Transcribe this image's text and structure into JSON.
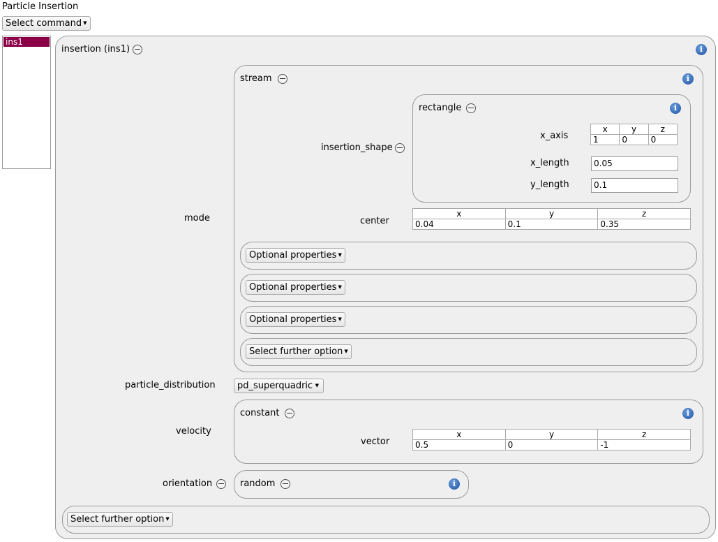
{
  "window_title": "Particle Insertion",
  "select_command": "Select command",
  "list_items": [
    "ins1"
  ],
  "insertion": {
    "title": "insertion (ins1)",
    "mode_label": "mode",
    "stream": {
      "title": "stream",
      "insertion_shape_label": "insertion_shape",
      "rectangle": {
        "title": "rectangle",
        "x_axis_label": "x_axis",
        "x_axis": {
          "headers": [
            "x",
            "y",
            "z"
          ],
          "values": [
            "1",
            "0",
            "0"
          ]
        },
        "x_length_label": "x_length",
        "x_length": "0.05",
        "y_length_label": "y_length",
        "y_length": "0.1"
      },
      "center_label": "center",
      "center": {
        "headers": [
          "x",
          "y",
          "z"
        ],
        "values": [
          "0.04",
          "0.1",
          "0.35"
        ]
      },
      "optional_properties": [
        "Optional properties",
        "Optional properties",
        "Optional properties"
      ],
      "select_further_option": "Select further option"
    },
    "particle_distribution_label": "particle_distribution",
    "particle_distribution": "pd_superquadric",
    "velocity_label": "velocity",
    "constant": {
      "title": "constant",
      "vector_label": "vector",
      "vector": {
        "headers": [
          "x",
          "y",
          "z"
        ],
        "values": [
          "0.5",
          "0",
          "-1"
        ]
      }
    },
    "orientation_label": "orientation",
    "orientation_value": "random",
    "select_further_option": "Select further option"
  },
  "icons": {
    "info": "info-icon",
    "collapse": "minus-circle-icon",
    "dropdown": "triangle-down-icon"
  },
  "colors": {
    "selection": "#8b0046",
    "info_blue": "#1e4f9e",
    "panel_bg": "#efefef"
  }
}
